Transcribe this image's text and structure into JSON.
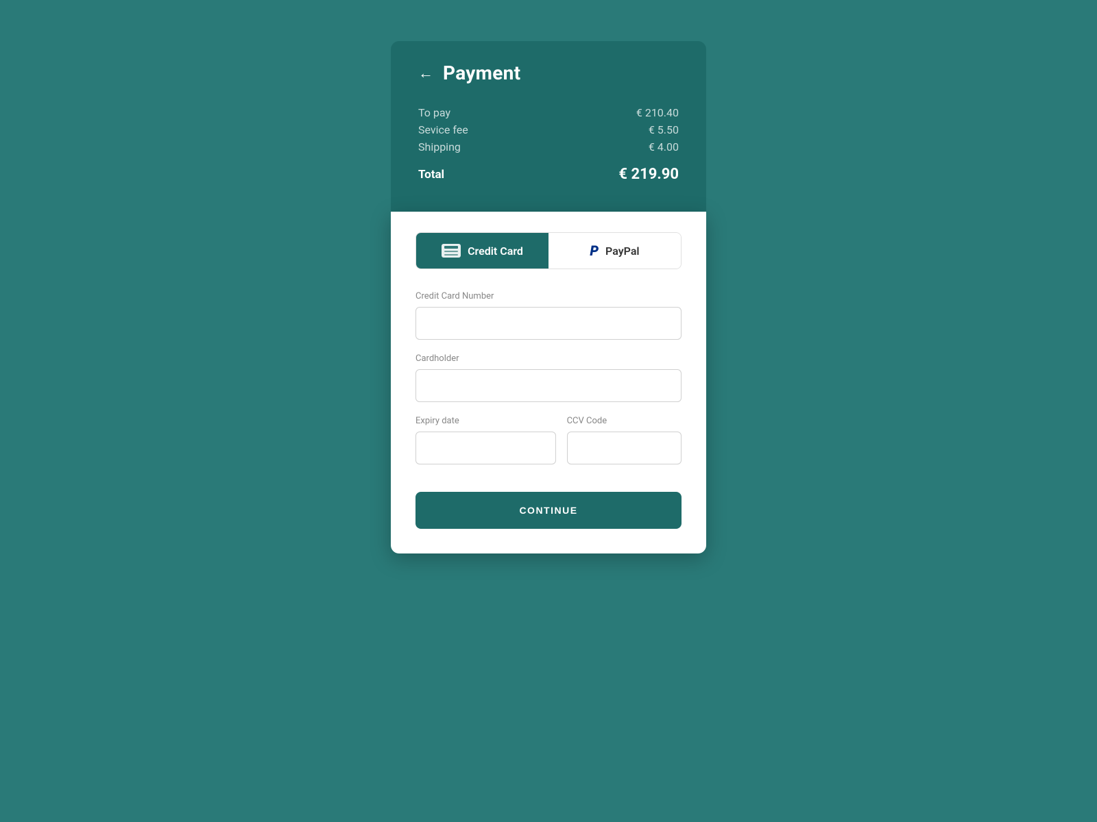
{
  "page": {
    "title": "Payment",
    "background_color": "#2a7a78"
  },
  "header": {
    "back_label": "←",
    "title": "Payment"
  },
  "pricing": {
    "rows": [
      {
        "label": "To pay",
        "value": "€ 210.40"
      },
      {
        "label": "Sevice fee",
        "value": "€ 5.50"
      },
      {
        "label": "Shipping",
        "value": "€ 4.00"
      }
    ],
    "total": {
      "label": "Total",
      "value": "€ 219.90"
    }
  },
  "payment_methods": {
    "tabs": [
      {
        "id": "credit-card",
        "label": "Credit Card",
        "active": true
      },
      {
        "id": "paypal",
        "label": "PayPal",
        "active": false
      }
    ]
  },
  "form": {
    "fields": [
      {
        "id": "card-number",
        "label": "Credit Card Number",
        "placeholder": ""
      },
      {
        "id": "cardholder",
        "label": "Cardholder",
        "placeholder": ""
      },
      {
        "id": "expiry",
        "label": "Expiry date",
        "placeholder": ""
      },
      {
        "id": "ccv",
        "label": "CCV Code",
        "placeholder": ""
      }
    ],
    "submit_label": "CONTINUE"
  }
}
